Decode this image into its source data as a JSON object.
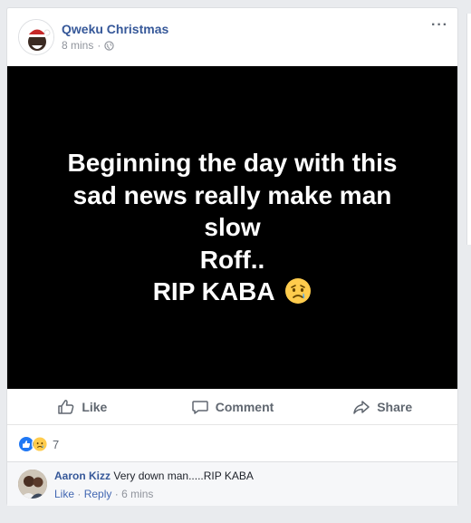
{
  "post": {
    "author": "Qweku Christmas",
    "time": "8 mins",
    "separator": "·",
    "more": "···",
    "privacy_icon": "globe-icon",
    "text_lines": [
      "Beginning the day with this",
      "sad news really make man",
      "slow",
      "Roff..",
      "RIP KABA"
    ],
    "emoji": "sad-crying-face-emoji"
  },
  "actions": {
    "like": "Like",
    "comment": "Comment",
    "share": "Share"
  },
  "reactions": {
    "count": "7"
  },
  "comment": {
    "author": "Aaron Kizz",
    "text": "Very down man.....RIP KABA",
    "like": "Like",
    "reply": "Reply",
    "time": "6 mins",
    "separator": "·"
  },
  "colors": {
    "link": "#365899",
    "like_blue": "#2078f4",
    "muted": "#90949c",
    "media_bg": "#000000"
  }
}
